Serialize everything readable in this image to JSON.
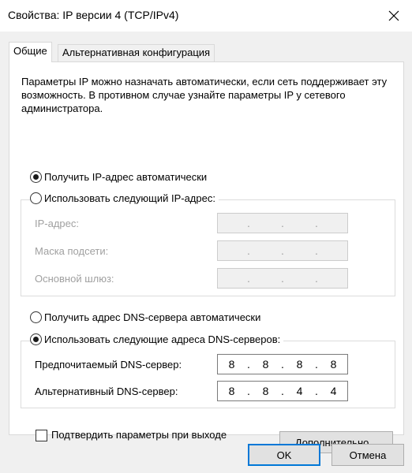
{
  "window": {
    "title": "Свойства: IP версии 4 (TCP/IPv4)",
    "close_icon": "close-icon"
  },
  "tabs": [
    {
      "label": "Общие",
      "active": true
    },
    {
      "label": "Альтернативная конфигурация",
      "active": false
    }
  ],
  "description": "Параметры IP можно назначать автоматически, если сеть поддерживает эту возможность. В противном случае узнайте параметры IP у сетевого администратора.",
  "ip": {
    "auto_label": "Получить IP-адрес автоматически",
    "manual_label": "Использовать следующий IP-адрес:",
    "selected": "auto",
    "fields": [
      {
        "label": "IP-адрес:",
        "octets": [
          "",
          "",
          "",
          ""
        ],
        "enabled": false
      },
      {
        "label": "Маска подсети:",
        "octets": [
          "",
          "",
          "",
          ""
        ],
        "enabled": false
      },
      {
        "label": "Основной шлюз:",
        "octets": [
          "",
          "",
          "",
          ""
        ],
        "enabled": false
      }
    ]
  },
  "dns": {
    "auto_label": "Получить адрес DNS-сервера автоматически",
    "manual_label": "Использовать следующие адреса DNS-серверов:",
    "selected": "manual",
    "fields": [
      {
        "label": "Предпочитаемый DNS-сервер:",
        "octets": [
          "8",
          "8",
          "8",
          "8"
        ],
        "enabled": true
      },
      {
        "label": "Альтернативный DNS-сервер:",
        "octets": [
          "8",
          "8",
          "4",
          "4"
        ],
        "enabled": true
      }
    ]
  },
  "validate": {
    "label": "Подтвердить параметры при выходе",
    "checked": false
  },
  "buttons": {
    "advanced": "Дополнительно...",
    "ok": "OK",
    "cancel": "Отмена"
  },
  "colors": {
    "accent": "#0078d7",
    "window_bg": "#f0f0f0",
    "disabled_text": "#a0a0a0"
  }
}
